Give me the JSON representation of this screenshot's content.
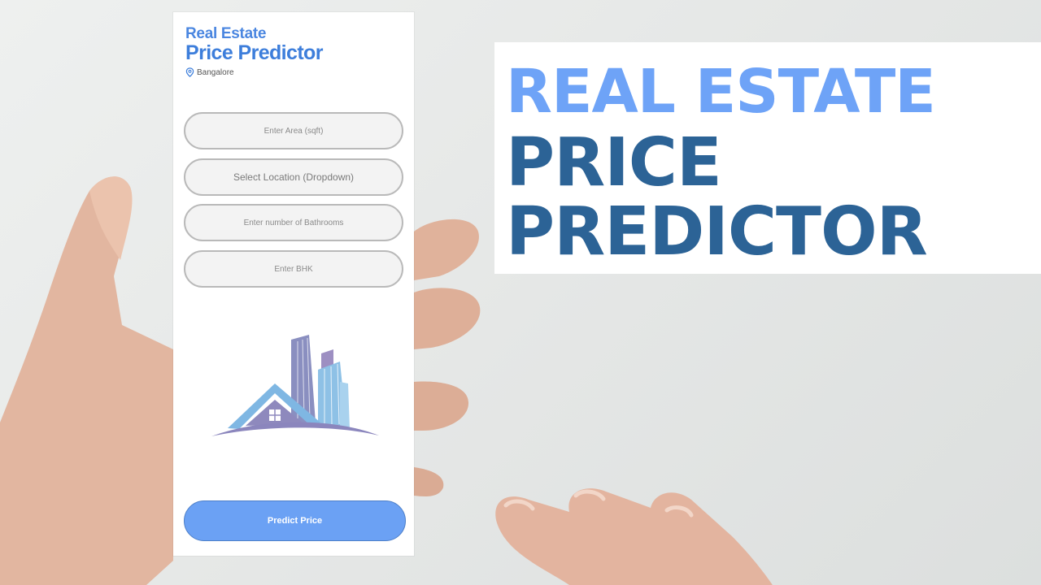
{
  "app": {
    "title_line1": "Real Estate",
    "title_line2": "Price Predictor",
    "location": "Bangalore"
  },
  "form": {
    "area_placeholder": "Enter Area (sqft)",
    "location_placeholder": "Select Location (Dropdown)",
    "bathrooms_placeholder": "Enter number of Bathrooms",
    "bhk_placeholder": "Enter BHK"
  },
  "actions": {
    "predict_label": "Predict Price"
  },
  "banner": {
    "line1": "REAL ESTATE",
    "line2": "PRICE",
    "line3": "PREDICTOR"
  },
  "colors": {
    "accent_light": "#6ea3f7",
    "accent_dark": "#2c6396",
    "button": "#6ba1f4"
  },
  "icons": {
    "location": "map-pin-icon",
    "logo": "house-buildings-logo"
  }
}
